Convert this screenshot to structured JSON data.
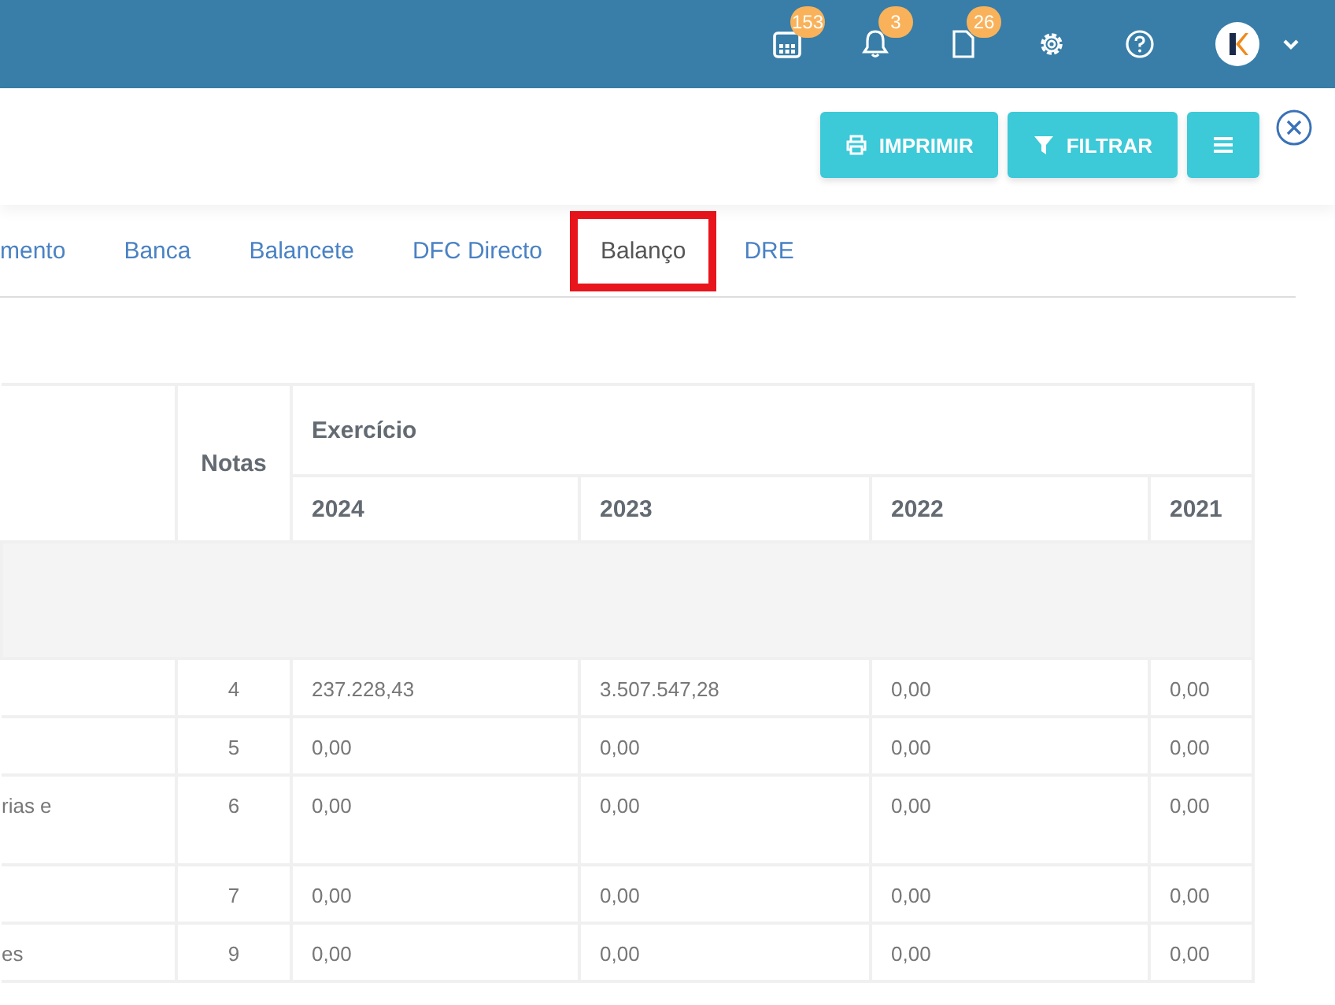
{
  "top_bar": {
    "icons": [
      {
        "kind": "calendar",
        "badge": "153"
      },
      {
        "kind": "bell",
        "badge": "3"
      },
      {
        "kind": "document",
        "badge": "26"
      },
      {
        "kind": "settings"
      },
      {
        "kind": "help"
      }
    ]
  },
  "toolbar": {
    "buttons": [
      {
        "kind": "print",
        "label": "IMPRIMIR"
      },
      {
        "kind": "filter",
        "label": "FILTRAR"
      },
      {
        "kind": "menu"
      }
    ]
  },
  "tabs": [
    {
      "label": "mento",
      "selected": false
    },
    {
      "label": "Banca",
      "selected": false
    },
    {
      "label": "Balancete",
      "selected": false
    },
    {
      "label": "DFC Directo",
      "selected": false
    },
    {
      "label": "Balanço",
      "selected": true
    },
    {
      "label": "DRE",
      "selected": false
    }
  ],
  "table": {
    "notes_header": "Notas",
    "group_header": "Exercício",
    "years": [
      "2024",
      "2023",
      "2022",
      "2021"
    ],
    "rows": [
      {
        "kind": "section"
      },
      {
        "kind": "data",
        "description": "",
        "notes": "4",
        "values": [
          "237.228,43",
          "3.507.547,28",
          "0,00",
          "0,00"
        ]
      },
      {
        "kind": "data",
        "description": "",
        "notes": "5",
        "values": [
          "0,00",
          "0,00",
          "0,00",
          "0,00"
        ]
      },
      {
        "kind": "data",
        "description": "rias e",
        "notes": "6",
        "values": [
          "0,00",
          "0,00",
          "0,00",
          "0,00"
        ],
        "tall": true
      },
      {
        "kind": "data",
        "description": "",
        "notes": "7",
        "values": [
          "0,00",
          "0,00",
          "0,00",
          "0,00"
        ]
      },
      {
        "kind": "data",
        "description": "es",
        "notes": "9",
        "values": [
          "0,00",
          "0,00",
          "0,00",
          "0,00"
        ]
      }
    ]
  }
}
